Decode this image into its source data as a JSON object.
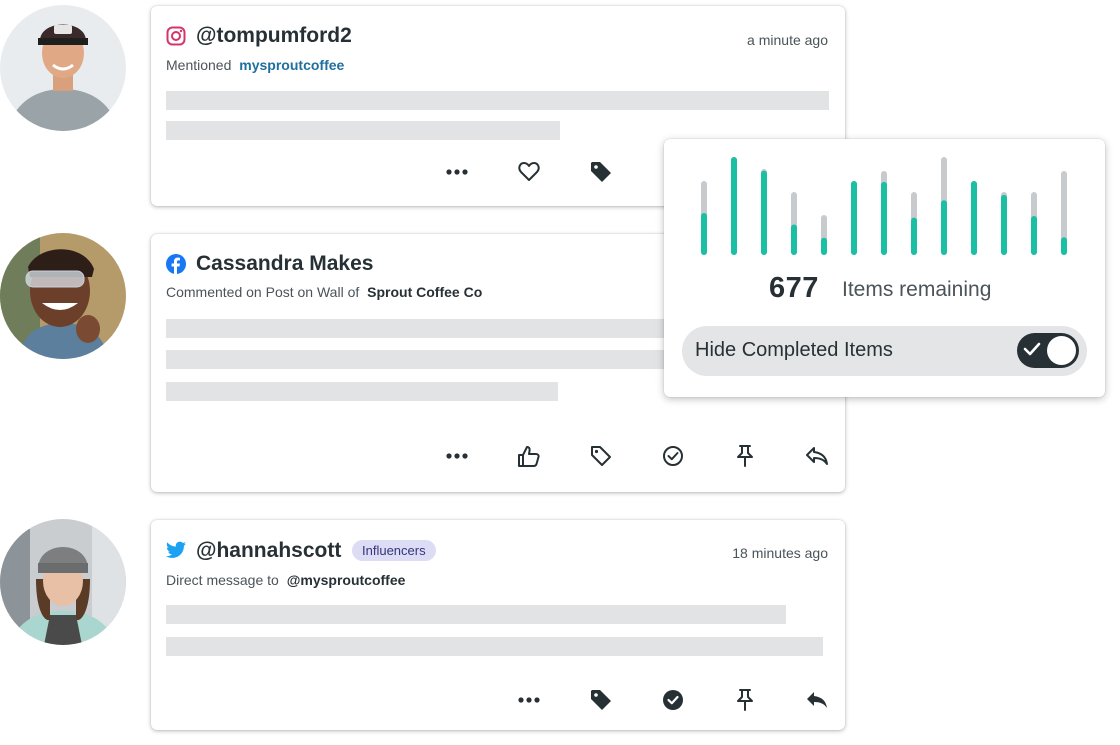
{
  "posts": [
    {
      "network_icon": "instagram-icon",
      "handle": "@tompumford2",
      "time": "a minute ago",
      "subtitle_prefix": "Mentioned",
      "subtitle_link": "mysproutcoffee",
      "actions": [
        "more-icon",
        "heart-icon",
        "tag-filled-icon"
      ]
    },
    {
      "network_icon": "facebook-icon",
      "handle": "Cassandra Makes",
      "subtitle_prefix": "Commented on Post on Wall of",
      "subtitle_bold": "Sprout Coffee Co",
      "actions": [
        "more-icon",
        "thumbs-up-icon",
        "tag-outline-icon",
        "check-circle-icon",
        "pin-icon",
        "reply-icon"
      ]
    },
    {
      "network_icon": "twitter-icon",
      "handle": "@hannahscott",
      "badge": "Influencers",
      "time": "18 minutes ago",
      "subtitle_prefix": "Direct message to",
      "subtitle_bold": "@mysproutcoffee",
      "actions": [
        "more-icon",
        "tag-filled-icon",
        "check-circle-filled-icon",
        "pin-icon",
        "reply-filled-icon"
      ]
    }
  ],
  "progress": {
    "count": "677",
    "label": "Items remaining",
    "toggle_label": "Hide Completed Items",
    "toggle_on": true,
    "bars_completed_fraction": [
      0.53,
      1.0,
      0.98,
      0.43,
      0.33,
      1.0,
      0.86,
      0.55,
      0.53,
      1.0,
      0.95,
      0.58,
      0.15
    ]
  },
  "colors": {
    "accent": "#1bbfa4",
    "bar_track": "#c8cbcd",
    "instagram": "#d6336c",
    "facebook": "#1877f2",
    "twitter": "#1da1f2",
    "badge_bg": "#dcdcf5"
  }
}
